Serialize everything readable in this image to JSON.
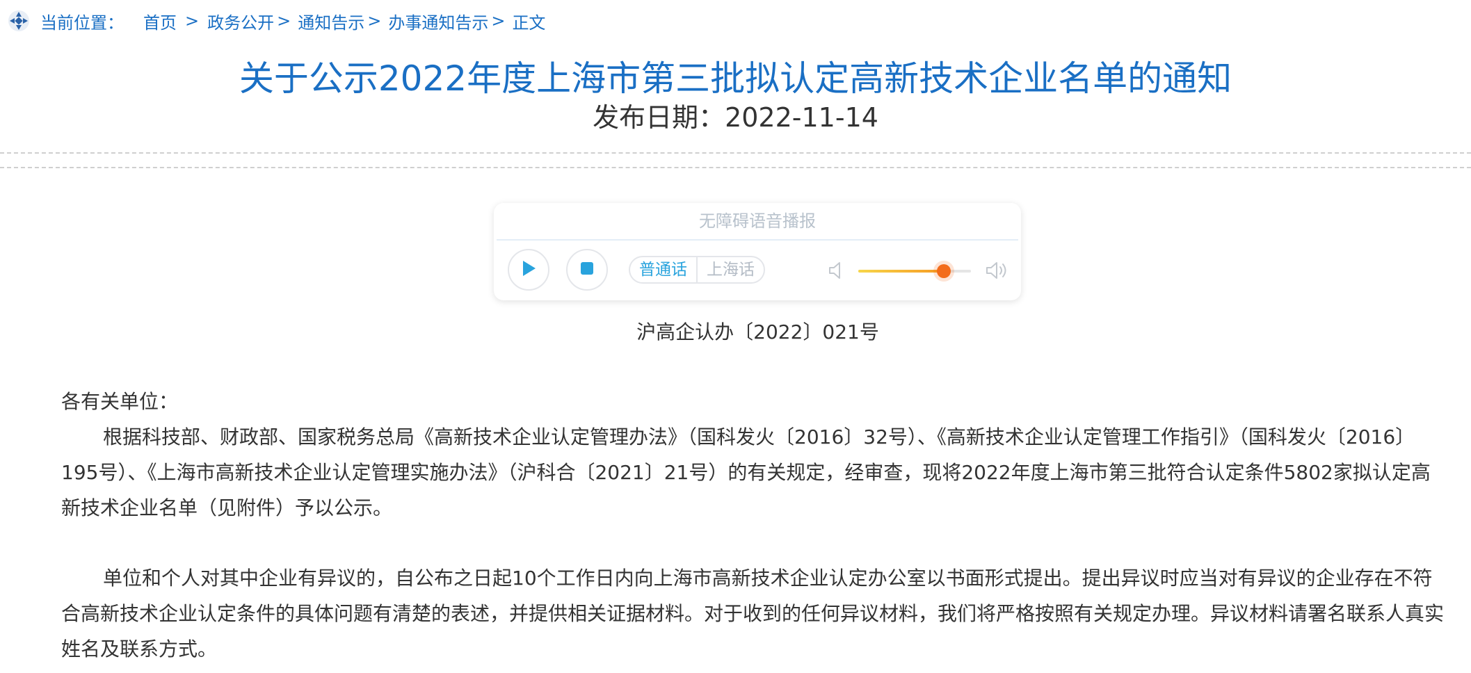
{
  "breadcrumb": {
    "label": "当前位置：",
    "items": [
      "首页",
      "政务公开",
      "通知告示",
      "办事通知告示",
      "正文"
    ],
    "separators": [
      ">",
      ">",
      ">",
      ">"
    ]
  },
  "article": {
    "title": "关于公示2022年度上海市第三批拟认定高新技术企业名单的通知",
    "date_line": "发布日期：2022-11-14",
    "doc_number": "沪高企认办〔2022〕021号",
    "salutation": "各有关单位：",
    "paragraph_1": "根据科技部、财政部、国家税务总局《高新技术企业认定管理办法》（国科发火〔2016〕32号）、《高新技术企业认定管理工作指引》（国科发火〔2016〕195号）、《上海市高新技术企业认定管理实施办法》（沪科合〔2021〕21号）的有关规定，经审查，现将2022年度上海市第三批符合认定条件5802家拟认定高新技术企业名单（见附件）予以公示。",
    "paragraph_2": "单位和个人对其中企业有异议的，自公布之日起10个工作日内向上海市高新技术企业认定办公室以书面形式提出。提出异议时应当对有异议的企业存在不符合高新技术企业认定条件的具体问题有清楚的表述，并提供相关证据材料。对于收到的任何异议材料，我们将严格按照有关规定办理。异议材料请署名联系人真实姓名及联系方式。"
  },
  "audio_player": {
    "title": "无障碍语音播报",
    "play_icon": "play-icon",
    "stop_icon": "stop-icon",
    "languages": [
      "普通话",
      "上海话"
    ],
    "selected_language": "普通话",
    "volume_level": 0.76,
    "colors": {
      "accent": "#29a3dd",
      "volume_start": "#f7d64a",
      "volume_end": "#f59a23",
      "knob": "#f36c1b"
    }
  },
  "colors": {
    "link": "#1a6fc4",
    "body_text": "#333333"
  }
}
